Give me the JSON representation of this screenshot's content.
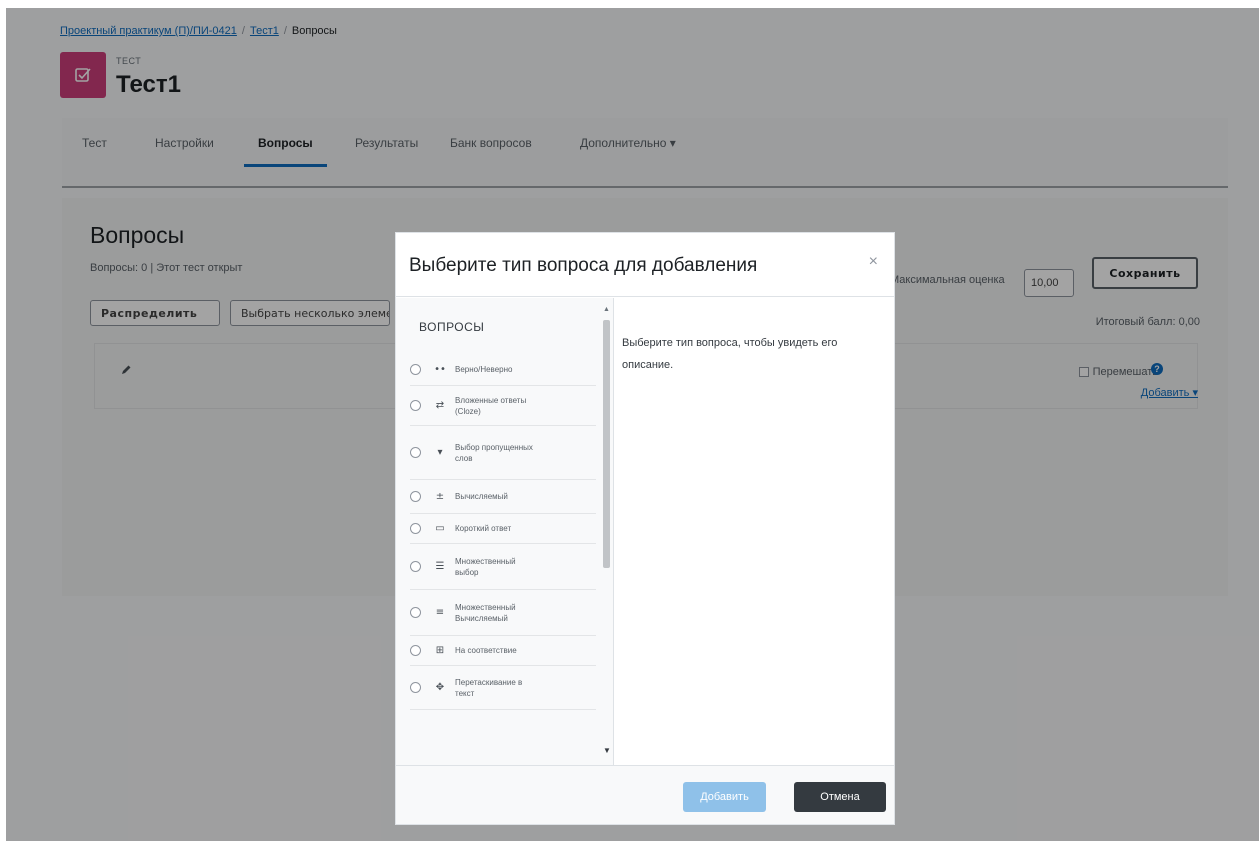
{
  "breadcrumb": {
    "course": "Проектный практикум (П)/ПИ-0421",
    "quiz": "Тест1",
    "current": "Вопросы",
    "separator": "/"
  },
  "header": {
    "kind": "ТЕСТ",
    "title": "Тест1",
    "icon": "quiz-icon",
    "icon_color": "#cb3d7a"
  },
  "nav": {
    "tabs": [
      "Тест",
      "Настройки",
      "Вопросы",
      "Результаты",
      "Банк вопросов",
      "Дополнительно ▾"
    ],
    "active": "Вопросы"
  },
  "page": {
    "title": "Вопросы",
    "info": "Вопросы: 0 | Этот тест открыт",
    "repaginate_label": "Распределить",
    "select_multiple_label": "Выбрать несколько элементов",
    "max_grade_label": "Максимальная оценка",
    "max_grade_value": "10,00",
    "save_label": "Сохранить",
    "total_grade": "Итоговый балл: 0,00",
    "shuffle_label": "Перемешать",
    "add_label": "Добавить ▾"
  },
  "modal": {
    "title": "Выберите тип вопроса для добавления",
    "close": "×",
    "section_heading": "ВОПРОСЫ",
    "items": [
      {
        "label": "Верно/Неверно",
        "icon": "dots-icon"
      },
      {
        "label": "Вложенные ответы (Cloze)",
        "icon": "cloze-icon"
      },
      {
        "label": "Выбор пропущенных слов",
        "icon": "dropdown-icon"
      },
      {
        "label": "Вычисляемый",
        "icon": "calculated-icon"
      },
      {
        "label": "Короткий ответ",
        "icon": "short-answer-icon"
      },
      {
        "label": "Множественный выбор",
        "icon": "multichoice-icon"
      },
      {
        "label": "Множественный Вычисляемый",
        "icon": "calculated-multi-icon"
      },
      {
        "label": "На соответствие",
        "icon": "match-icon"
      },
      {
        "label": "Перетаскивание в текст",
        "icon": "drag-icon"
      }
    ],
    "description": "Выберите тип вопроса, чтобы увидеть его описание.",
    "add_label": "Добавить",
    "cancel_label": "Отмена"
  },
  "colors": {
    "accent": "#0f6cbf",
    "add_button": "#8fc1e9",
    "cancel_button": "#343a40"
  }
}
